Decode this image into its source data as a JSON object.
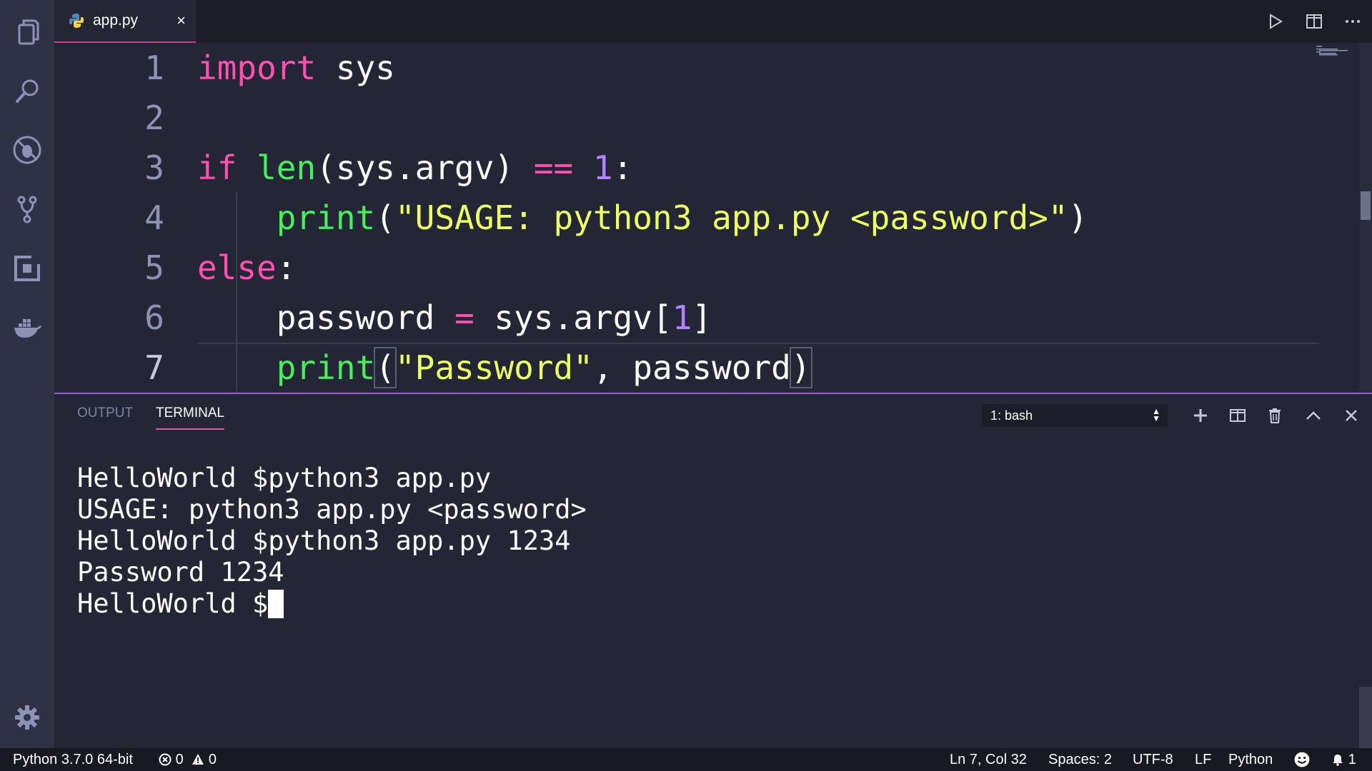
{
  "tab": {
    "filename": "app.py",
    "close": "×"
  },
  "editor": {
    "lines": [
      {
        "num": "1"
      },
      {
        "num": "2"
      },
      {
        "num": "3"
      },
      {
        "num": "4"
      },
      {
        "num": "5"
      },
      {
        "num": "6"
      },
      {
        "num": "7"
      }
    ],
    "code": {
      "l1_kw": "import",
      "l1_rest": " sys",
      "l3_kw": "if",
      "l3_fn": "len",
      "l3_a": "(sys.argv) ",
      "l3_op": "==",
      "l3_num": "1",
      "l3_b": ":",
      "l4_fn": "print",
      "l4_a": "(",
      "l4_str": "\"USAGE: python3 app.py <password>\"",
      "l4_b": ")",
      "l5_kw": "else",
      "l5_b": ":",
      "l6_a": "password ",
      "l6_op": "=",
      "l6_b": " sys.argv[",
      "l6_num": "1",
      "l6_c": "]",
      "l7_fn": "print",
      "l7_a": "(",
      "l7_str": "\"Password\"",
      "l7_b": ", password",
      "l7_c": ")"
    }
  },
  "panel": {
    "tabs": {
      "output": "OUTPUT",
      "terminal": "TERMINAL"
    },
    "terminal_select": "1: bash",
    "terminal_lines": [
      "HelloWorld $python3 app.py",
      "USAGE: python3 app.py <password>",
      "HelloWorld $python3 app.py 1234",
      "Password 1234"
    ],
    "prompt": "HelloWorld $"
  },
  "status": {
    "interpreter": "Python 3.7.0 64-bit",
    "errors": "0",
    "warnings": "0",
    "position": "Ln 7, Col 32",
    "spaces": "Spaces: 2",
    "encoding": "UTF-8",
    "eol": "LF",
    "language": "Python",
    "notifications": "1"
  },
  "colors": {
    "accent": "#c93f8a",
    "panel_border": "#9b5ad6",
    "keyword": "#ff4fb0",
    "function": "#45f05a",
    "string": "#ecff61",
    "number": "#b084ff"
  }
}
